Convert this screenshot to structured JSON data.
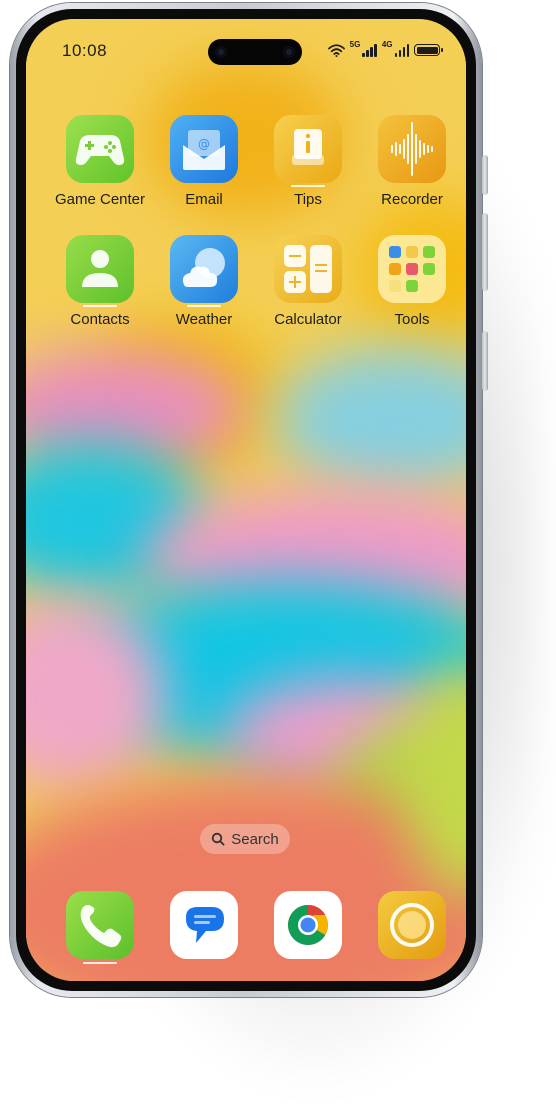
{
  "status_bar": {
    "time": "10:08",
    "network_labels": [
      "5G",
      "4G"
    ]
  },
  "apps": [
    {
      "label": "Game Center",
      "icon": "gamepad-icon",
      "color": "#7ed23a"
    },
    {
      "label": "Email",
      "icon": "envelope-icon",
      "color": "#2f8ee6"
    },
    {
      "label": "Tips",
      "icon": "info-card-icon",
      "color": "#f0b81c"
    },
    {
      "label": "Recorder",
      "icon": "waveform-icon",
      "color": "#f0a417"
    },
    {
      "label": "Contacts",
      "icon": "person-icon",
      "color": "#78d03a"
    },
    {
      "label": "Weather",
      "icon": "cloud-icon",
      "color": "#2f95e8"
    },
    {
      "label": "Calculator",
      "icon": "calculator-icon",
      "color": "#efbd23"
    },
    {
      "label": "Tools",
      "icon": "folder-icon",
      "color": "#f6e07c"
    }
  ],
  "search": {
    "label": "Search"
  },
  "dock": [
    {
      "app": "Phone",
      "icon": "phone-icon",
      "color": "#78d03a"
    },
    {
      "app": "Messages",
      "icon": "message-bubble-icon",
      "color": "#1a73e8"
    },
    {
      "app": "Chrome",
      "icon": "chrome-icon",
      "color": "#ffffff"
    },
    {
      "app": "Camera",
      "icon": "camera-ring-icon",
      "color": "#eab21a"
    }
  ]
}
